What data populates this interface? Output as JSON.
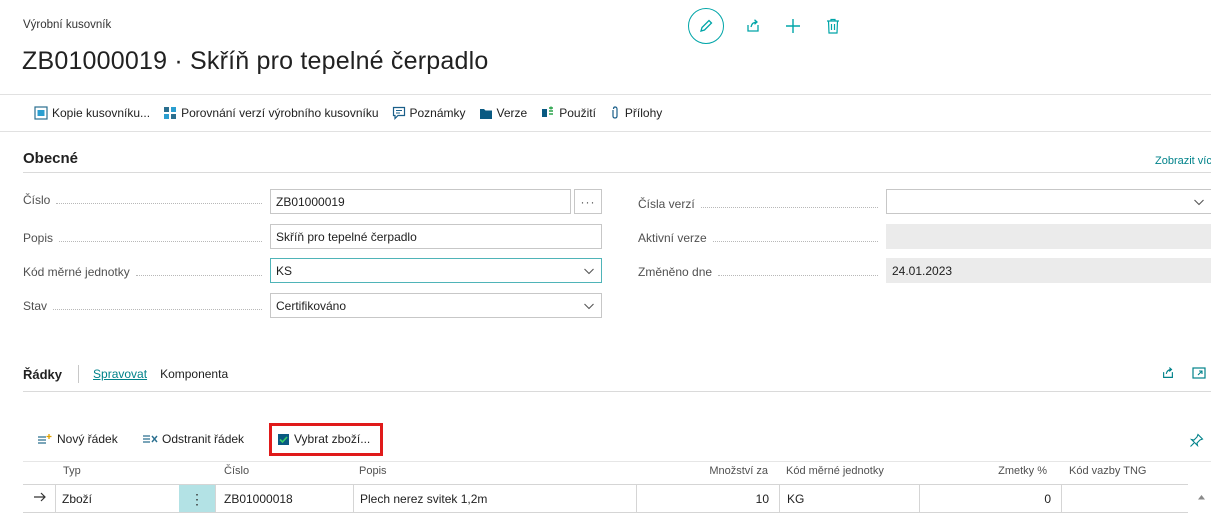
{
  "header": {
    "caption": "Výrobní kusovník",
    "title": "ZB01000019 · Skříň pro tepelné čerpadlo"
  },
  "actions": [
    {
      "label": "Kopie kusovníku...",
      "icon": "copy-document-icon"
    },
    {
      "label": "Porovnání verzí výrobního kusovníku",
      "icon": "compare-versions-icon"
    },
    {
      "label": "Poznámky",
      "icon": "notes-icon"
    },
    {
      "label": "Verze",
      "icon": "folder-icon"
    },
    {
      "label": "Použití",
      "icon": "where-used-icon"
    },
    {
      "label": "Přílohy",
      "icon": "attachment-icon"
    }
  ],
  "general": {
    "title": "Obecné",
    "show_more": "Zobrazit víc",
    "fields": {
      "cislo_label": "Číslo",
      "cislo_value": "ZB01000019",
      "popis_label": "Popis",
      "popis_value": "Skříň pro tepelné čerpadlo",
      "kod_label": "Kód měrné jednotky",
      "kod_value": "KS",
      "stav_label": "Stav",
      "stav_value": "Certifikováno",
      "cisla_verzi_label": "Čísla verzí",
      "cisla_verzi_value": "",
      "aktivni_verze_label": "Aktivní verze",
      "aktivni_verze_value": "",
      "zmeneno_label": "Změněno dne",
      "zmeneno_value": "24.01.2023"
    }
  },
  "lines": {
    "title": "Řádky",
    "tabs": [
      "Spravovat",
      "Komponenta"
    ],
    "buttons": {
      "new_line": "Nový řádek",
      "delete_line": "Odstranit řádek",
      "select_items": "Vybrat zboží..."
    },
    "columns": [
      "Typ",
      "Číslo",
      "Popis",
      "Množství za",
      "Kód měrné jednotky",
      "Zmetky %",
      "Kód vazby TNG"
    ],
    "rows": [
      {
        "typ": "Zboží",
        "cislo": "ZB01000018",
        "popis": "Plech nerez svitek 1,2m",
        "mnozstvi": "10",
        "kod": "KG",
        "zmetky": "0",
        "vazba": ""
      }
    ]
  },
  "colors": {
    "accent": "#00a5a8",
    "link": "#00828a",
    "highlight": "#e01a1a"
  }
}
